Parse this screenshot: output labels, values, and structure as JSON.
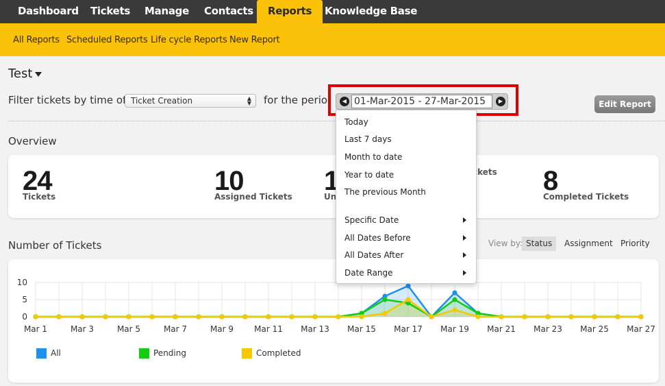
{
  "topnav": {
    "tabs": [
      {
        "label": "Dashboard"
      },
      {
        "label": "Tickets"
      },
      {
        "label": "Manage"
      },
      {
        "label": "Contacts"
      },
      {
        "label": "Reports",
        "active": true
      },
      {
        "label": "Knowledge Base"
      }
    ]
  },
  "subnav": {
    "links": [
      "All Reports",
      "Scheduled Reports",
      "Life cycle Reports",
      "New Report"
    ]
  },
  "report": {
    "title": "Test",
    "filter_label": "Filter tickets by time of",
    "filter_value": "Ticket Creation",
    "period_label": "for the period",
    "date_range": "01-Mar-2015 - 27-Mar-2015",
    "edit_button": "Edit Report"
  },
  "overview": {
    "title": "Overview",
    "stats": [
      {
        "value": "24",
        "label": "Tickets"
      },
      {
        "value": "10",
        "label": "Assigned Tickets"
      },
      {
        "value": "1",
        "label": "Un"
      },
      {
        "value": "",
        "label": "ckets"
      },
      {
        "value": "8",
        "label": "Completed Tickets"
      }
    ]
  },
  "tickets_chart": {
    "title": "Number of Tickets",
    "viewby_label": "View by:",
    "viewby_options": [
      {
        "label": "Status",
        "active": true
      },
      {
        "label": "Assignment"
      },
      {
        "label": "Priority"
      }
    ]
  },
  "date_menu": {
    "items": [
      {
        "label": "Today"
      },
      {
        "label": "Last 7 days"
      },
      {
        "label": "Month to date"
      },
      {
        "label": "Year to date"
      },
      {
        "label": "The previous Month"
      },
      {
        "label": "Specific Date",
        "submenu": true
      },
      {
        "label": "All Dates Before",
        "submenu": true
      },
      {
        "label": "All Dates After",
        "submenu": true
      },
      {
        "label": "Date Range",
        "submenu": true
      }
    ]
  },
  "colors": {
    "topnav_bg": "#3a3a3a",
    "accent": "#fbc209",
    "highlight": "#e00000",
    "all": "#1e90ee",
    "pending": "#13cc13",
    "completed": "#f5c800"
  },
  "chart_data": {
    "type": "line",
    "x": [
      "Mar 1",
      "Mar 2",
      "Mar 3",
      "Mar 4",
      "Mar 5",
      "Mar 6",
      "Mar 7",
      "Mar 8",
      "Mar 9",
      "Mar 10",
      "Mar 11",
      "Mar 12",
      "Mar 13",
      "Mar 14",
      "Mar 15",
      "Mar 16",
      "Mar 17",
      "Mar 18",
      "Mar 19",
      "Mar 20",
      "Mar 21",
      "Mar 22",
      "Mar 23",
      "Mar 24",
      "Mar 25",
      "Mar 26",
      "Mar 27"
    ],
    "x_tick_labels": [
      "Mar 1",
      "Mar 3",
      "Mar 5",
      "Mar 7",
      "Mar 9",
      "Mar 11",
      "Mar 13",
      "Mar 15",
      "Mar 17",
      "Mar 19",
      "Mar 21",
      "Mar 23",
      "Mar 25",
      "Mar 27"
    ],
    "y_ticks": [
      "0",
      "5",
      "10"
    ],
    "ylim": [
      0,
      10
    ],
    "series": [
      {
        "name": "All",
        "color": "#1e90ee",
        "values": [
          0,
          0,
          0,
          0,
          0,
          0,
          0,
          0,
          0,
          0,
          0,
          0,
          0,
          0,
          1,
          6,
          9,
          0,
          7,
          1,
          0,
          0,
          0,
          0,
          0,
          0,
          0
        ]
      },
      {
        "name": "Pending",
        "color": "#13cc13",
        "values": [
          0,
          0,
          0,
          0,
          0,
          0,
          0,
          0,
          0,
          0,
          0,
          0,
          0,
          0,
          1,
          5,
          4,
          0,
          5,
          1,
          0,
          0,
          0,
          0,
          0,
          0,
          0
        ]
      },
      {
        "name": "Completed",
        "color": "#f5c800",
        "values": [
          0,
          0,
          0,
          0,
          0,
          0,
          0,
          0,
          0,
          0,
          0,
          0,
          0,
          0,
          0,
          1,
          5,
          0,
          2,
          0,
          0,
          0,
          0,
          0,
          0,
          0,
          0
        ]
      }
    ],
    "legend_position": "bottom"
  }
}
